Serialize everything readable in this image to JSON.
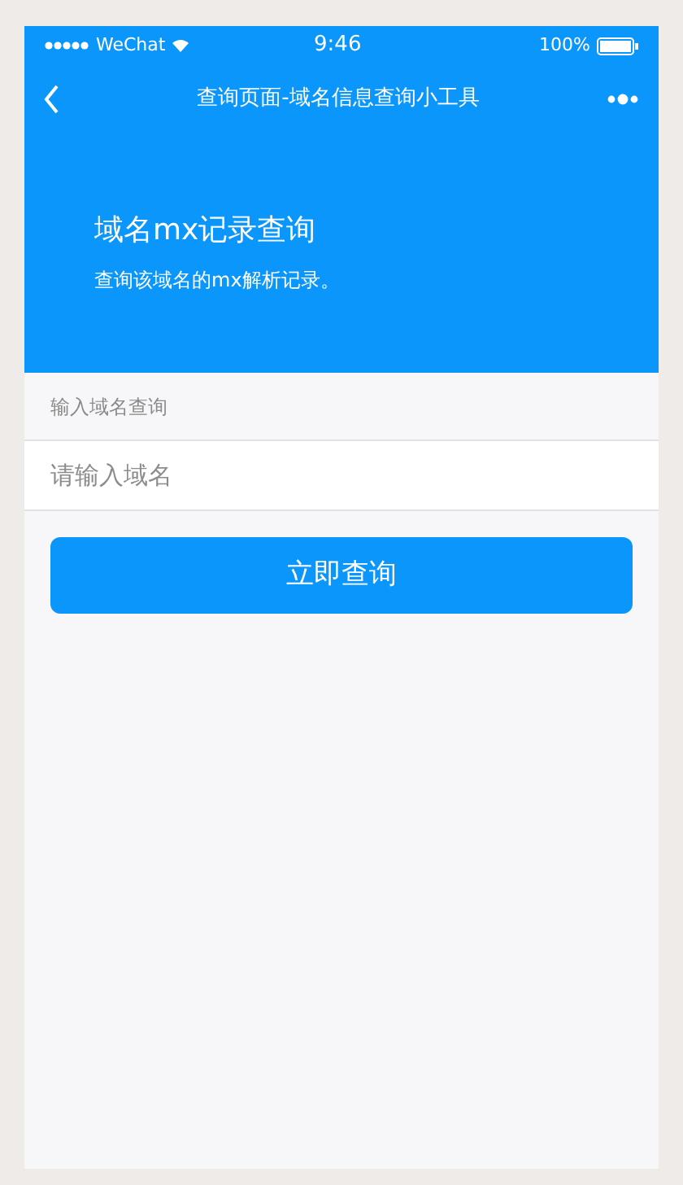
{
  "status_bar": {
    "carrier": "WeChat",
    "time": "9:46",
    "battery": "100%"
  },
  "nav": {
    "title": "查询页面-域名信息查询小工具"
  },
  "hero": {
    "title": "域名mx记录查询",
    "subtitle": "查询该域名的mx解析记录。"
  },
  "form": {
    "label": "输入域名查询",
    "placeholder": "请输入域名",
    "button": "立即查询"
  }
}
